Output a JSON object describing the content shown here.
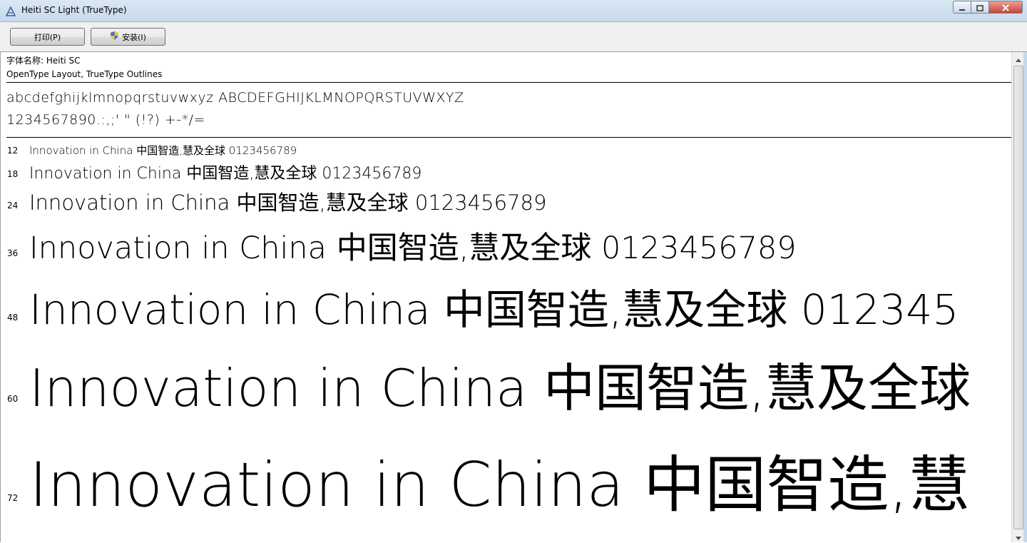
{
  "window": {
    "title": "Heiti SC Light (TrueType)",
    "icon": "font-file-icon",
    "controls": [
      "minimize-icon",
      "maximize-icon",
      "close-icon"
    ]
  },
  "toolbar": {
    "print_label": "打印(P)",
    "install_label": "安装(I)",
    "install_icon": "uac-shield-icon"
  },
  "font_info": {
    "name_line": "字体名称: Heiti SC",
    "type_line": "OpenType Layout, TrueType Outlines"
  },
  "charset": {
    "line1": "abcdefghijklmnopqrstuvwxyz ABCDEFGHIJKLMNOPQRSTUVWXYZ",
    "line2": "1234567890.:,;' \" (!?) +-*/="
  },
  "samples": [
    {
      "size": "12",
      "text": "Innovation in China 中国智造,慧及全球 0123456789"
    },
    {
      "size": "18",
      "text": "Innovation in China 中国智造,慧及全球 0123456789"
    },
    {
      "size": "24",
      "text": "Innovation in China 中国智造,慧及全球 0123456789"
    },
    {
      "size": "36",
      "text": "Innovation in China 中国智造,慧及全球 0123456789"
    },
    {
      "size": "48",
      "text": "Innovation in China 中国智造,慧及全球 012345"
    },
    {
      "size": "60",
      "text": "Innovation in China 中国智造,慧及全球"
    },
    {
      "size": "72",
      "text": "Innovation in China 中国智造,慧"
    }
  ]
}
